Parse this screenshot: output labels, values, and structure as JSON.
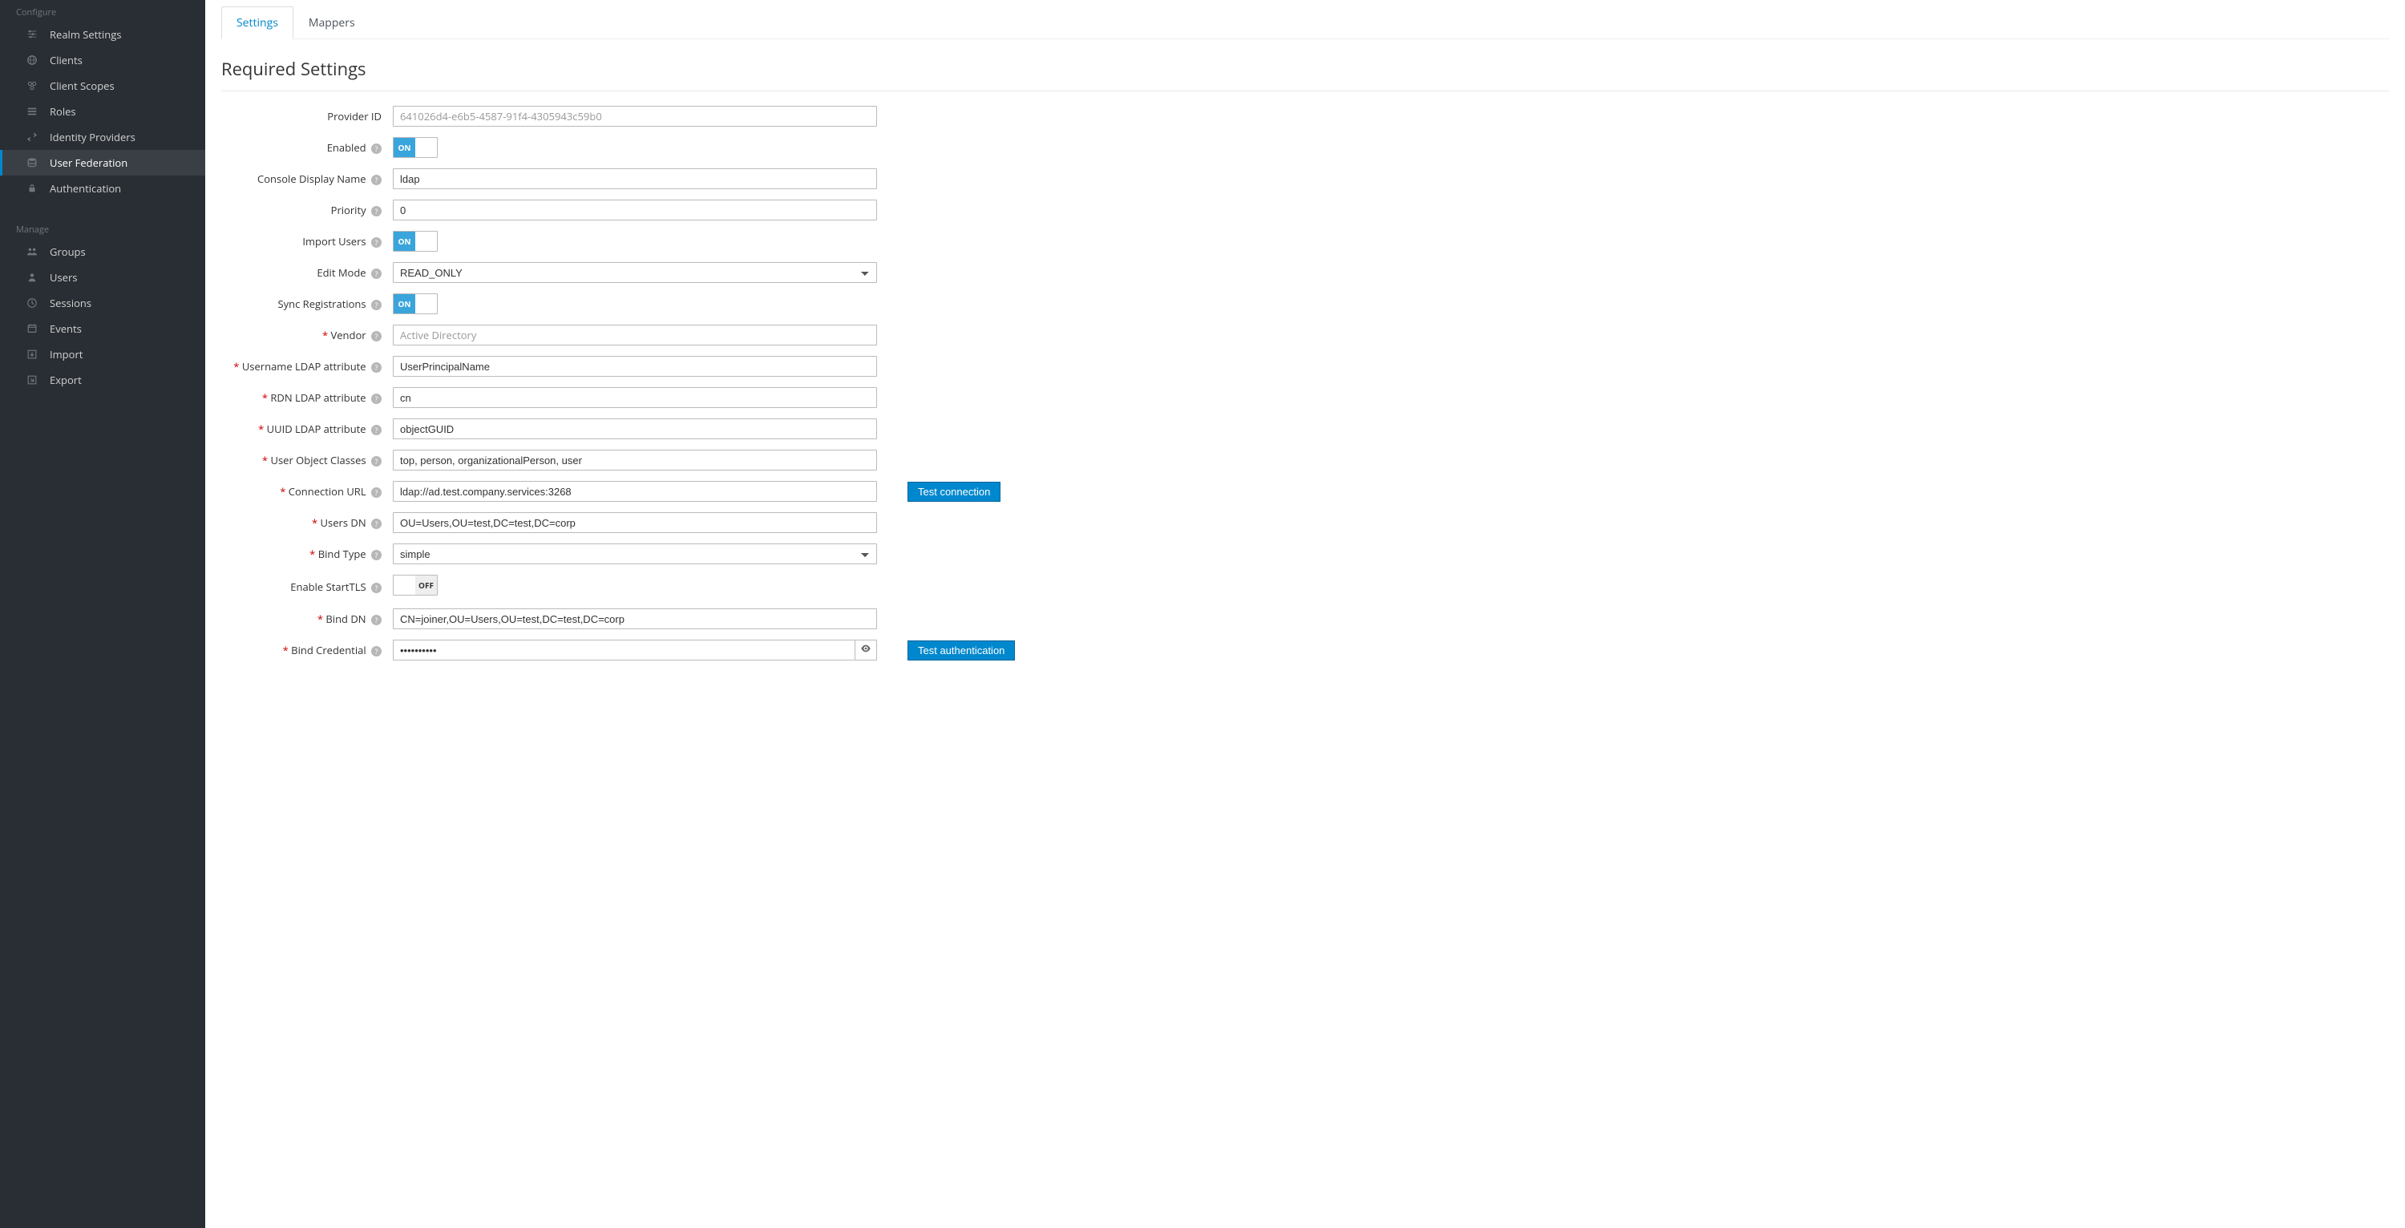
{
  "sidebar": {
    "sections": {
      "configure": {
        "title": "Configure",
        "items": [
          {
            "label": "Realm Settings"
          },
          {
            "label": "Clients"
          },
          {
            "label": "Client Scopes"
          },
          {
            "label": "Roles"
          },
          {
            "label": "Identity Providers"
          },
          {
            "label": "User Federation"
          },
          {
            "label": "Authentication"
          }
        ]
      },
      "manage": {
        "title": "Manage",
        "items": [
          {
            "label": "Groups"
          },
          {
            "label": "Users"
          },
          {
            "label": "Sessions"
          },
          {
            "label": "Events"
          },
          {
            "label": "Import"
          },
          {
            "label": "Export"
          }
        ]
      }
    }
  },
  "tabs": {
    "settings": "Settings",
    "mappers": "Mappers"
  },
  "section_title": "Required Settings",
  "labels": {
    "provider_id": "Provider ID",
    "enabled": "Enabled",
    "console_display_name": "Console Display Name",
    "priority": "Priority",
    "import_users": "Import Users",
    "edit_mode": "Edit Mode",
    "sync_registrations": "Sync Registrations",
    "vendor": "Vendor",
    "username_ldap_attr": "Username LDAP attribute",
    "rdn_ldap_attr": "RDN LDAP attribute",
    "uuid_ldap_attr": "UUID LDAP attribute",
    "user_object_classes": "User Object Classes",
    "connection_url": "Connection URL",
    "users_dn": "Users DN",
    "bind_type": "Bind Type",
    "enable_starttls": "Enable StartTLS",
    "bind_dn": "Bind DN",
    "bind_credential": "Bind Credential"
  },
  "values": {
    "provider_id": "641026d4-e6b5-4587-91f4-4305943c59b0",
    "console_display_name": "ldap",
    "priority": "0",
    "edit_mode": "READ_ONLY",
    "vendor": "Active Directory",
    "username_ldap_attr": "UserPrincipalName",
    "rdn_ldap_attr": "cn",
    "uuid_ldap_attr": "objectGUID",
    "user_object_classes": "top, person, organizationalPerson, user",
    "connection_url": "ldap://ad.test.company.services:3268",
    "users_dn": "OU=Users,OU=test,DC=test,DC=corp",
    "bind_type": "simple",
    "bind_dn": "CN=joiner,OU=Users,OU=test,DC=test,DC=corp",
    "bind_credential": "••••••••••"
  },
  "toggles": {
    "on": "ON",
    "off": "OFF"
  },
  "buttons": {
    "test_connection": "Test connection",
    "test_authentication": "Test authentication"
  }
}
